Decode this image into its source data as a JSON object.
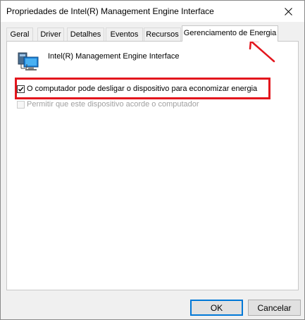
{
  "window": {
    "title": "Propriedades de Intel(R) Management Engine Interface",
    "close_glyph": "✕"
  },
  "tabs": [
    {
      "label": "Geral",
      "active": false
    },
    {
      "label": "Driver",
      "active": false
    },
    {
      "label": "Detalhes",
      "active": false
    },
    {
      "label": "Eventos",
      "active": false
    },
    {
      "label": "Recursos",
      "active": false
    },
    {
      "label": "Gerenciamento de Energia",
      "active": true
    }
  ],
  "device": {
    "icon": "network-adapter-icon",
    "name": "Intel(R) Management Engine Interface"
  },
  "options": {
    "allow_turn_off": {
      "label": "O computador pode desligar o dispositivo para economizar energia",
      "checked": true,
      "enabled": true
    },
    "allow_wake": {
      "label": "Permitir que este dispositivo acorde o computador",
      "checked": false,
      "enabled": false
    }
  },
  "buttons": {
    "ok": "OK",
    "cancel": "Cancelar"
  },
  "annotation": {
    "color": "#e3161d"
  }
}
